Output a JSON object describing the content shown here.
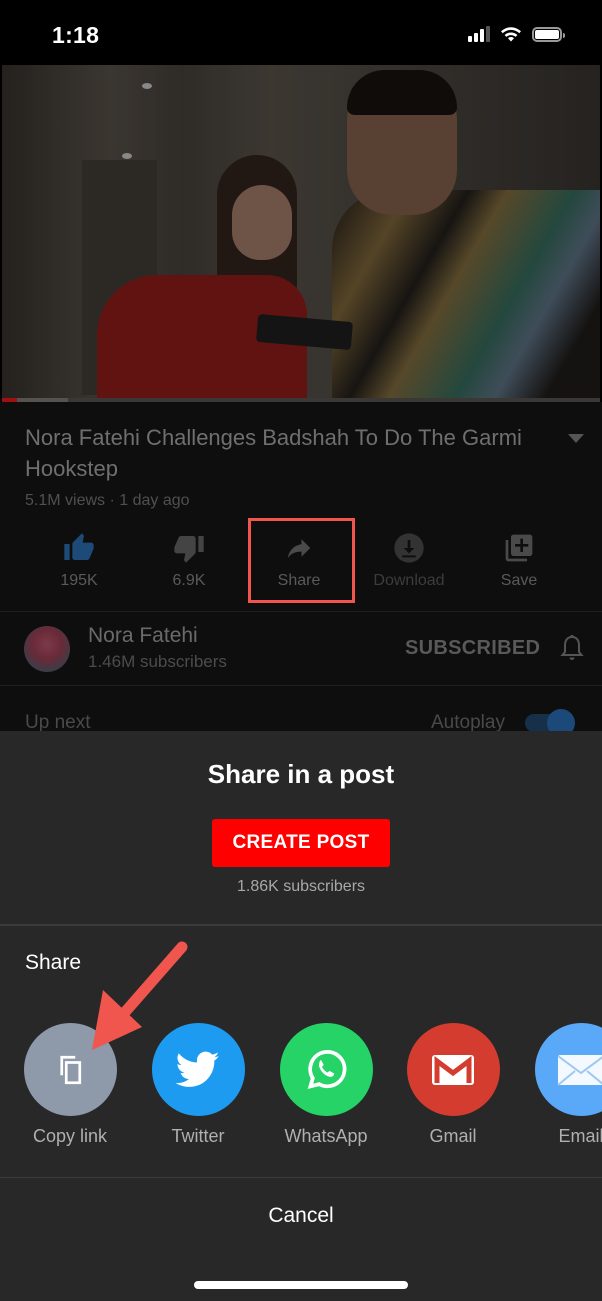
{
  "status_bar": {
    "time": "1:18",
    "icons": [
      "signal-icon",
      "wifi-icon",
      "battery-icon"
    ]
  },
  "video": {
    "progress_played_fraction": 0.025,
    "progress_buffered_fraction": 0.11,
    "colors": {
      "played": "#a01010"
    }
  },
  "info": {
    "title": "Nora Fatehi Challenges Badshah To Do The Garmi Hookstep",
    "meta": "5.1M views · 1 day ago",
    "actions": [
      {
        "id": "like",
        "label": "195K",
        "icon": "thumbs-up-icon",
        "active": true
      },
      {
        "id": "dislike",
        "label": "6.9K",
        "icon": "thumbs-down-icon"
      },
      {
        "id": "share",
        "label": "Share",
        "icon": "share-arrow-icon",
        "highlighted": true
      },
      {
        "id": "download",
        "label": "Download",
        "icon": "download-icon",
        "disabled": true
      },
      {
        "id": "save",
        "label": "Save",
        "icon": "add-to-playlist-icon"
      }
    ],
    "channel": {
      "name": "Nora Fatehi",
      "subscribers": "1.46M subscribers",
      "subscribe_label": "SUBSCRIBED"
    },
    "up_next_label": "Up next",
    "autoplay_label": "Autoplay",
    "autoplay_on": true
  },
  "sheet": {
    "title": "Share in a post",
    "create_post_label": "CREATE POST",
    "post_subscribers": "1.86K subscribers",
    "share_label": "Share",
    "targets": [
      {
        "label": "Copy link",
        "icon": "copy-link-icon",
        "color": "#8e99aa"
      },
      {
        "label": "Twitter",
        "icon": "twitter-icon",
        "color": "#1d9bf0"
      },
      {
        "label": "WhatsApp",
        "icon": "whatsapp-icon",
        "color": "#25d366"
      },
      {
        "label": "Gmail",
        "icon": "gmail-icon",
        "color": "#d33c2e"
      },
      {
        "label": "Email",
        "icon": "email-icon",
        "color": "#5aa9f8"
      }
    ],
    "cancel_label": "Cancel"
  },
  "annotation": {
    "color": "#f0564d"
  }
}
